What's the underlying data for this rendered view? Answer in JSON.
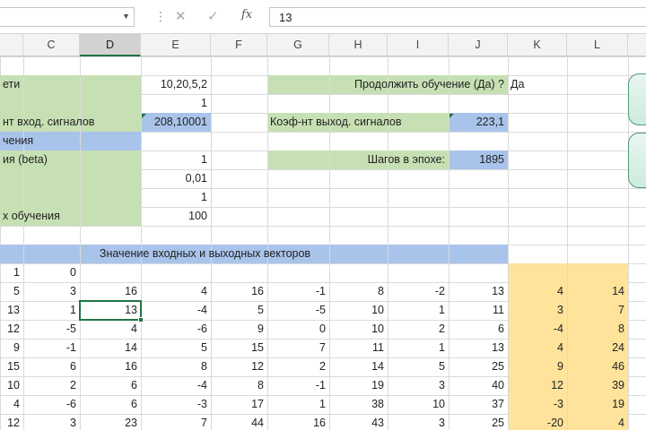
{
  "formula_bar": {
    "name_box": "",
    "cancel_icon": "✕",
    "enter_icon": "✓",
    "fx_label": "fx",
    "value": "13"
  },
  "columns": [
    "C",
    "D",
    "E",
    "F",
    "G",
    "H",
    "I",
    "J",
    "K",
    "L"
  ],
  "selected_column": "D",
  "colors": {
    "green_fill": "#c6e0b4",
    "blue_fill": "#a9c4eb",
    "orange_fill": "#ffe39b",
    "selection": "#217346"
  },
  "params": {
    "row1_label": "ети",
    "row1_value": "10,20,5,2",
    "row2_value": "1",
    "row3_label": "нт вход. сигналов",
    "row3_value": "208,10001",
    "row4_label": "чения",
    "row5_label": "ия (beta)",
    "row5_value": "1",
    "row6_value": "0,01",
    "row7_value": "1",
    "row8_label": "х обучения",
    "row8_value": "100"
  },
  "right_panel": {
    "continue_label": "Продолжить обучение (Да) ?",
    "continue_value": "Да",
    "out_coef_label": "Коэф-нт выход. сигналов",
    "out_coef_value": "223,1",
    "steps_label": "Шагов в  эпохе:",
    "steps_value": "1895"
  },
  "vectors_header": "Значение входных и выходных векторов",
  "table": {
    "row0": [
      "1",
      "0"
    ],
    "rows": [
      [
        "5",
        "3",
        "16",
        "4",
        "16",
        "-1",
        "8",
        "-2",
        "13",
        "4",
        "14"
      ],
      [
        "13",
        "1",
        "13",
        "-4",
        "5",
        "-5",
        "10",
        "1",
        "11",
        "3",
        "7"
      ],
      [
        "12",
        "-5",
        "4",
        "-6",
        "9",
        "0",
        "10",
        "2",
        "6",
        "-4",
        "8"
      ],
      [
        "9",
        "-1",
        "14",
        "5",
        "15",
        "7",
        "11",
        "1",
        "13",
        "4",
        "24"
      ],
      [
        "15",
        "6",
        "16",
        "8",
        "12",
        "2",
        "14",
        "5",
        "25",
        "9",
        "46"
      ],
      [
        "10",
        "2",
        "6",
        "-4",
        "8",
        "-1",
        "19",
        "3",
        "40",
        "12",
        "39"
      ],
      [
        "4",
        "-6",
        "6",
        "-3",
        "17",
        "1",
        "38",
        "10",
        "37",
        "-3",
        "19"
      ],
      [
        "12",
        "3",
        "23",
        "7",
        "44",
        "16",
        "43",
        "3",
        "25",
        "-20",
        "4"
      ]
    ]
  }
}
